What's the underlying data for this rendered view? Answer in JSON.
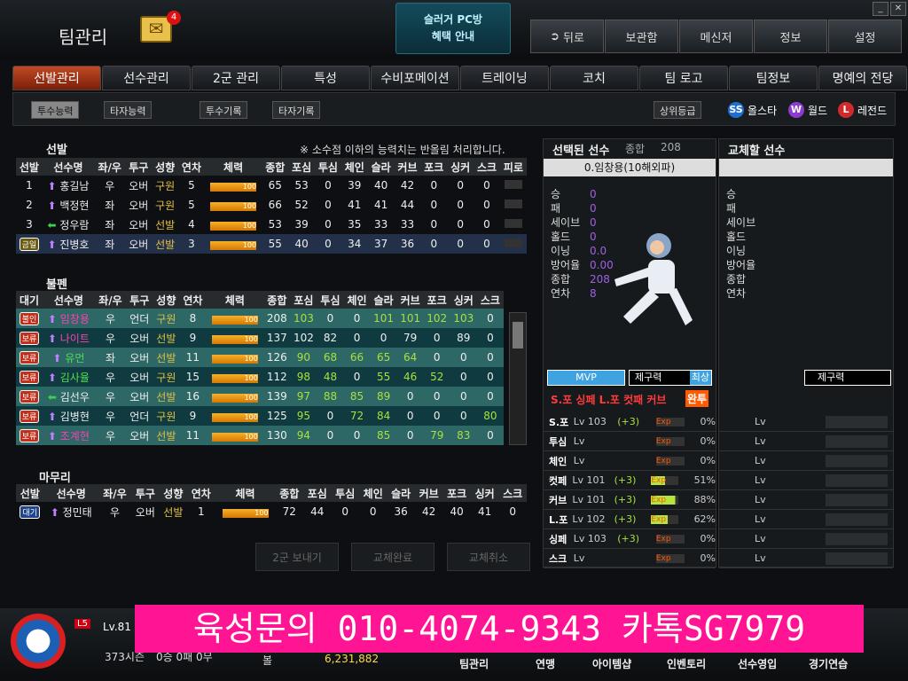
{
  "top": {
    "title": "팀관리",
    "mail_count": "4",
    "promo_line1": "슬러거 PC방",
    "promo_line2": "혜택 안내",
    "menu": [
      "뒤로",
      "보관함",
      "메신저",
      "정보",
      "설정"
    ]
  },
  "tabs": [
    "선발관리",
    "선수관리",
    "2군 관리",
    "특성",
    "수비포메이션",
    "트레이닝",
    "코치",
    "팀 로고",
    "팀정보",
    "명예의 전당"
  ],
  "subtabs": {
    "a": "투수능력",
    "b": "타자능력",
    "c": "투수기록",
    "d": "타자기록",
    "rank": "상위등급"
  },
  "legend": [
    {
      "k": "SS",
      "label": "올스타",
      "color": "#1f6fd0"
    },
    {
      "k": "W",
      "label": "월드",
      "color": "#8d3ad0"
    },
    {
      "k": "L",
      "label": "레전드",
      "color": "#d02a2a"
    }
  ],
  "starter": {
    "title": "선발",
    "note": "※ 소수점 이하의 능력치는 반올림 처리합니다.",
    "headers": [
      "선발",
      "선수명",
      "좌/우",
      "투구",
      "성향",
      "연차",
      "체력",
      "종합",
      "포심",
      "투심",
      "체인",
      "슬라",
      "커브",
      "포크",
      "싱커",
      "스크",
      "피로"
    ],
    "rows": [
      [
        "1",
        "홍길남",
        "우",
        "오버",
        "구원",
        "5",
        "100",
        "65",
        "53",
        "0",
        "39",
        "40",
        "42",
        "0",
        "0",
        "0"
      ],
      [
        "2",
        "백정현",
        "좌",
        "오버",
        "구원",
        "5",
        "100",
        "66",
        "52",
        "0",
        "41",
        "41",
        "44",
        "0",
        "0",
        "0"
      ],
      [
        "3",
        "정우람",
        "좌",
        "오버",
        "선발",
        "4",
        "100",
        "53",
        "39",
        "0",
        "35",
        "33",
        "33",
        "0",
        "0",
        "0"
      ],
      [
        "금일",
        "진병호",
        "좌",
        "오버",
        "선발",
        "3",
        "100",
        "55",
        "40",
        "0",
        "34",
        "37",
        "36",
        "0",
        "0",
        "0"
      ]
    ]
  },
  "bullpen": {
    "title": "불펜",
    "headers": [
      "대기",
      "선수명",
      "좌/우",
      "투구",
      "성향",
      "연차",
      "체력",
      "종합",
      "포심",
      "투심",
      "체인",
      "슬라",
      "커브",
      "포크",
      "싱커",
      "스크"
    ],
    "rows": [
      [
        "불인",
        "임창용",
        "우",
        "언더",
        "구원",
        "8",
        "100",
        "208",
        "103",
        "0",
        "0",
        "101",
        "101",
        "102",
        "103",
        "0"
      ],
      [
        "보류",
        "나이트",
        "우",
        "오버",
        "선발",
        "9",
        "100",
        "137",
        "102",
        "82",
        "0",
        "0",
        "79",
        "0",
        "89",
        "0"
      ],
      [
        "보류",
        "유먼",
        "좌",
        "오버",
        "선발",
        "11",
        "100",
        "126",
        "90",
        "68",
        "66",
        "65",
        "64",
        "0",
        "0",
        "0"
      ],
      [
        "보류",
        "김사율",
        "우",
        "오버",
        "구원",
        "15",
        "100",
        "112",
        "98",
        "48",
        "0",
        "55",
        "46",
        "52",
        "0",
        "0"
      ],
      [
        "보류",
        "김선우",
        "우",
        "오버",
        "선발",
        "16",
        "100",
        "139",
        "97",
        "88",
        "85",
        "89",
        "0",
        "0",
        "0",
        "0"
      ],
      [
        "보류",
        "김병현",
        "우",
        "언더",
        "구원",
        "9",
        "100",
        "125",
        "95",
        "0",
        "72",
        "84",
        "0",
        "0",
        "0",
        "80"
      ],
      [
        "보류",
        "조계현",
        "우",
        "오버",
        "선발",
        "11",
        "100",
        "130",
        "94",
        "0",
        "0",
        "85",
        "0",
        "79",
        "83",
        "0"
      ]
    ]
  },
  "closer": {
    "title": "마무리",
    "headers": [
      "선발",
      "선수명",
      "좌/우",
      "투구",
      "성향",
      "연차",
      "체력",
      "종합",
      "포심",
      "투심",
      "체인",
      "슬라",
      "커브",
      "포크",
      "싱커",
      "스크"
    ],
    "rows": [
      [
        "대기",
        "정민태",
        "우",
        "오버",
        "선발",
        "1",
        "100",
        "72",
        "44",
        "0",
        "0",
        "36",
        "42",
        "40",
        "41",
        "0"
      ]
    ]
  },
  "selected": {
    "title": "선택된 선수",
    "total_label": "종합",
    "total": "208",
    "name": "0.임창용(10해외파)",
    "stats": [
      [
        "승",
        "0"
      ],
      [
        "패",
        "0"
      ],
      [
        "세이브",
        "0"
      ],
      [
        "홀드",
        "0"
      ],
      [
        "이닝",
        "0.0"
      ],
      [
        "방어율",
        "0.00"
      ],
      [
        "종합",
        "208"
      ],
      [
        "연차",
        "8"
      ]
    ],
    "mvp": "MVP",
    "control": "제구력",
    "control_val": "최상",
    "specialty": "S.포 싱페 L.포 컷패 커브",
    "specialty_btn": "완투",
    "skills": [
      [
        "S.포",
        "Lv 103",
        "(+3)",
        "0%"
      ],
      [
        "투심",
        "Lv",
        "",
        "0%"
      ],
      [
        "체인",
        "Lv",
        "",
        "0%"
      ],
      [
        "컷페",
        "Lv 101",
        "(+3)",
        "51%"
      ],
      [
        "커브",
        "Lv 101",
        "(+3)",
        "88%"
      ],
      [
        "L.포",
        "Lv 102",
        "(+3)",
        "62%"
      ],
      [
        "싱페",
        "Lv 103",
        "(+3)",
        "0%"
      ],
      [
        "스크",
        "Lv",
        "",
        "0%"
      ]
    ],
    "exp_label": "Exp"
  },
  "replace": {
    "title": "교체할 선수",
    "stats": [
      "승",
      "패",
      "세이브",
      "홀드",
      "이닝",
      "방어율",
      "종합",
      "연차"
    ],
    "control": "제구력",
    "lv": "Lv"
  },
  "buttons": [
    "2군 보내기",
    "교체완료",
    "교체취소"
  ],
  "footer": {
    "level": "Lv.81",
    "season": "373시즌",
    "record": "0승 0패 0무",
    "money_label": "볼",
    "money": "6,231,882",
    "menu": [
      "팀관리",
      "연맹",
      "아이템샵",
      "인벤토리",
      "선수영입",
      "경기연습"
    ]
  },
  "ad": "육성문의 010-4074-9343 카톡SG7979"
}
